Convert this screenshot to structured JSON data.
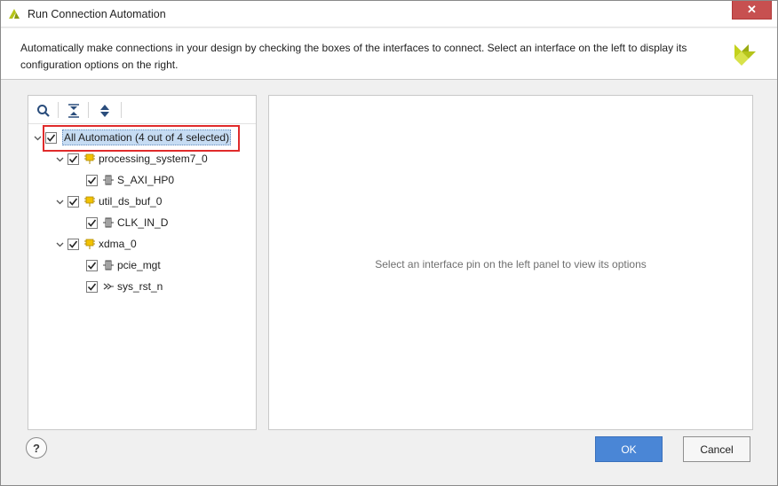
{
  "window": {
    "title": "Run Connection Automation",
    "close_label": "✕",
    "description": "Automatically make connections in your design by checking the boxes of the interfaces to connect. Select an interface on the left to display its configuration options on the right."
  },
  "toolbar": {
    "icons": [
      "search-icon",
      "collapse-all-icon",
      "expand-all-icon"
    ]
  },
  "tree": {
    "root": {
      "label": "All Automation (4 out of 4 selected)",
      "checked": true,
      "expanded": true
    },
    "nodes": [
      {
        "label": "processing_system7_0",
        "icon": "ip-block-icon",
        "checked": true,
        "expanded": true,
        "children": [
          {
            "label": "S_AXI_HP0",
            "icon": "bus-interface-icon",
            "checked": true
          }
        ]
      },
      {
        "label": "util_ds_buf_0",
        "icon": "ip-block-icon",
        "checked": true,
        "expanded": true,
        "children": [
          {
            "label": "CLK_IN_D",
            "icon": "bus-interface-icon",
            "checked": true
          }
        ]
      },
      {
        "label": "xdma_0",
        "icon": "ip-block-icon",
        "checked": true,
        "expanded": true,
        "children": [
          {
            "label": "pcie_mgt",
            "icon": "bus-interface-icon",
            "checked": true
          },
          {
            "label": "sys_rst_n",
            "icon": "reset-pin-icon",
            "checked": true
          }
        ]
      }
    ]
  },
  "right_panel": {
    "hint": "Select an interface pin on the left panel to view its options"
  },
  "buttons": {
    "help": "?",
    "ok": "OK",
    "cancel": "Cancel"
  },
  "colors": {
    "accent": "#4a86d6",
    "highlight": "#e02b2b",
    "selection": "#c6dcf3",
    "brand": "#b5c41a"
  }
}
